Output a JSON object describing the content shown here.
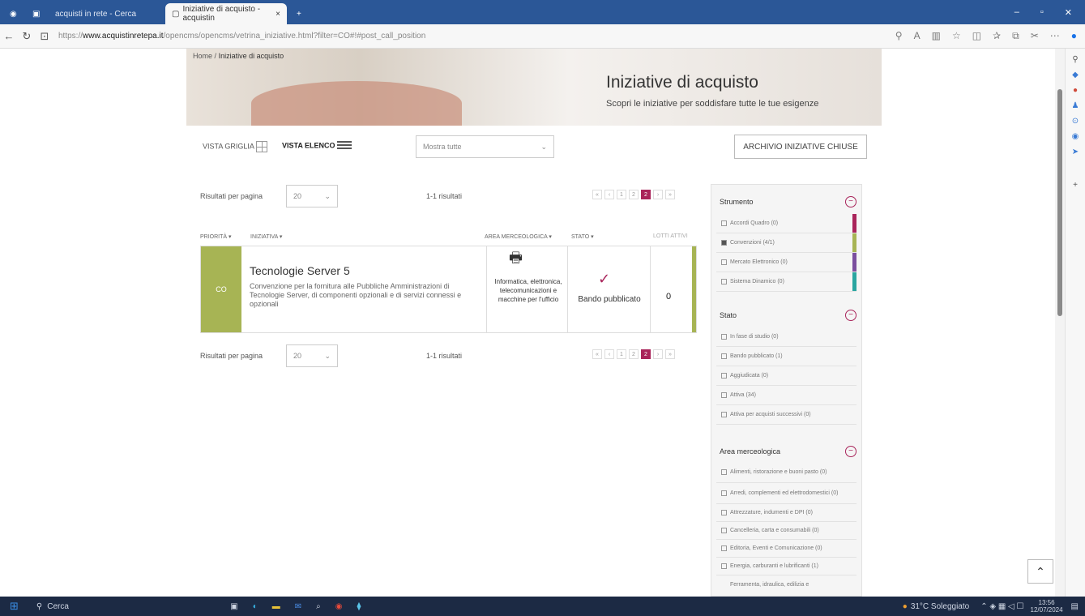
{
  "browser": {
    "tabs": [
      {
        "label": "acquisti in rete - Cerca"
      },
      {
        "label": "Iniziative di acquisto - acquistin"
      }
    ],
    "new_tab": "+",
    "url_prefix": "https://",
    "url_host": "www.acquistinretepa.it",
    "url_path": "/opencms/opencms/vetrina_iniziative.html?filter=CO#!#post_call_position"
  },
  "breadcrumb": {
    "home": "Home",
    "sep": "/",
    "current": "Iniziative di acquisto"
  },
  "banner": {
    "title": "Iniziative di acquisto",
    "subtitle": "Scopri le iniziative per soddisfare tutte le tue esigenze"
  },
  "view": {
    "grid_label": "VISTA GRIGLIA",
    "list_label": "VISTA ELENCO"
  },
  "filter_select": {
    "placeholder": "Mostra tutte"
  },
  "archive_button": "ARCHIVIO INIZIATIVE CHIUSE",
  "results": {
    "per_page_label": "Risultati per pagina",
    "per_page_value": "20",
    "count_text": "1-1 risultati",
    "pages": [
      "«",
      "‹",
      "1",
      "2",
      "›",
      "»"
    ],
    "active_page": "2"
  },
  "columns": [
    "PRIORITÀ",
    "INIZIATIVA",
    "AREA MERCEOLOGICA",
    "STATO",
    "LOTTI ATTIVI"
  ],
  "item": {
    "badge": "CO",
    "title": "Tecnologie Server 5",
    "description": "Convenzione per la fornitura alle Pubbliche Amministrazioni di Tecnologie Server, di componenti opzionali e di servizi connessi e opzionali",
    "area": "Informatica, elettronica, telecomunicazioni e macchine per l'ufficio",
    "status": "Bando pubblicato",
    "lots": "0"
  },
  "facets": {
    "strumento": {
      "title": "Strumento",
      "items": [
        {
          "label": "Accordi Quadro (0)",
          "color": "#a9245a",
          "checked": false
        },
        {
          "label": "Convenzioni (4/1)",
          "color": "#a7b454",
          "checked": true
        },
        {
          "label": "Mercato Elettronico (0)",
          "color": "#7b4f9e",
          "checked": false
        },
        {
          "label": "Sistema Dinamico (0)",
          "color": "#2aa5a0",
          "checked": false
        }
      ]
    },
    "stato": {
      "title": "Stato",
      "items": [
        "In fase di studio (0)",
        "Bando pubblicato (1)",
        "Aggiudicata (0)",
        "Attiva (34)",
        "Attiva per acquisti successivi (0)"
      ]
    },
    "area": {
      "title": "Area merceologica",
      "items": [
        "Alimenti, ristorazione e buoni pasto (0)",
        "Arredi, complementi ed elettrodomestici (0)",
        "Attrezzature, indumenti e DPI (0)",
        "Cancelleria, carta e consumabili (0)",
        "Editoria, Eventi e Comunicazione (0)",
        "Energia, carburanti e lubrificanti (1)",
        "Ferramenta, idraulica, edilizia e"
      ]
    }
  },
  "taskbar": {
    "search": "Cerca",
    "weather": "31°C Soleggiato",
    "time": "13:56",
    "date": "12/07/2024"
  },
  "icons": {
    "scroll_top": "chevron-up-icon",
    "printer": "printer-icon",
    "check": "checkmark-icon"
  }
}
